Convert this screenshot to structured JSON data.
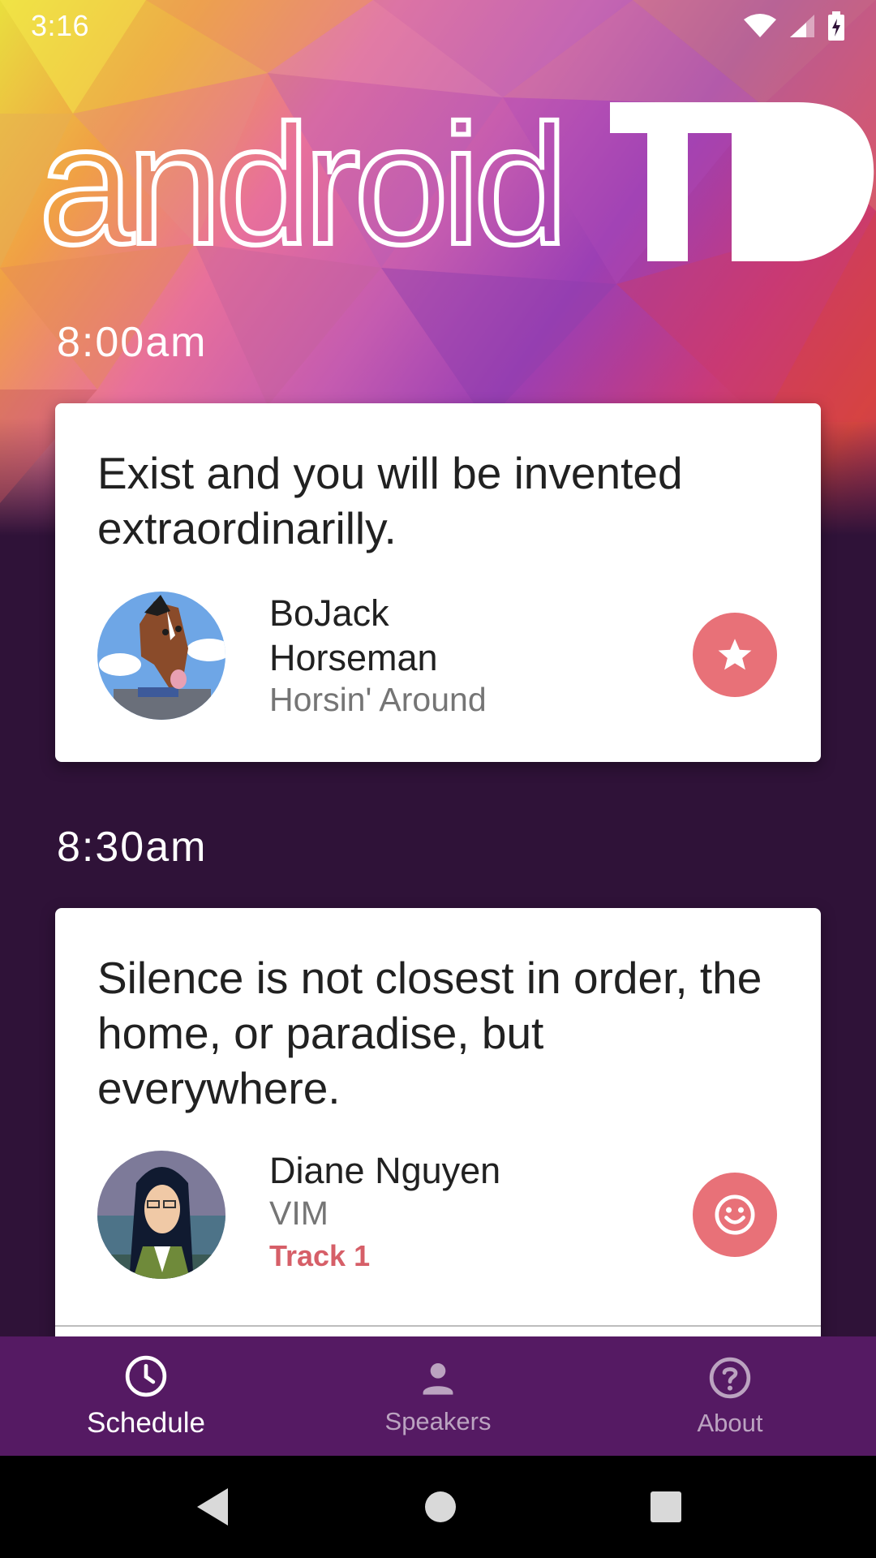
{
  "status_bar": {
    "time": "3:16"
  },
  "header": {
    "logo_text": "android",
    "logo_suffix": "TO"
  },
  "schedule": [
    {
      "time": "8:00am",
      "title": "Exist and you will be invented extraordinarilly.",
      "speaker_name": "BoJack Horseman",
      "company": "Horsin' Around",
      "track": "",
      "action_icon": "star-icon"
    },
    {
      "time": "8:30am",
      "title": "Silence is not closest in order, the home, or paradise, but everywhere.",
      "speaker_name": "Diane Nguyen",
      "company": "VIM",
      "track": "Track 1",
      "action_icon": "smiley-icon"
    }
  ],
  "bottom_nav": {
    "items": [
      {
        "label": "Schedule",
        "icon": "clock-icon",
        "active": true
      },
      {
        "label": "Speakers",
        "icon": "person-icon",
        "active": false
      },
      {
        "label": "About",
        "icon": "help-circle-icon",
        "active": false
      }
    ]
  },
  "colors": {
    "accent": "#e87178",
    "track": "#d65f68",
    "nav_background": "#551a63",
    "page_background": "#2f1238"
  }
}
